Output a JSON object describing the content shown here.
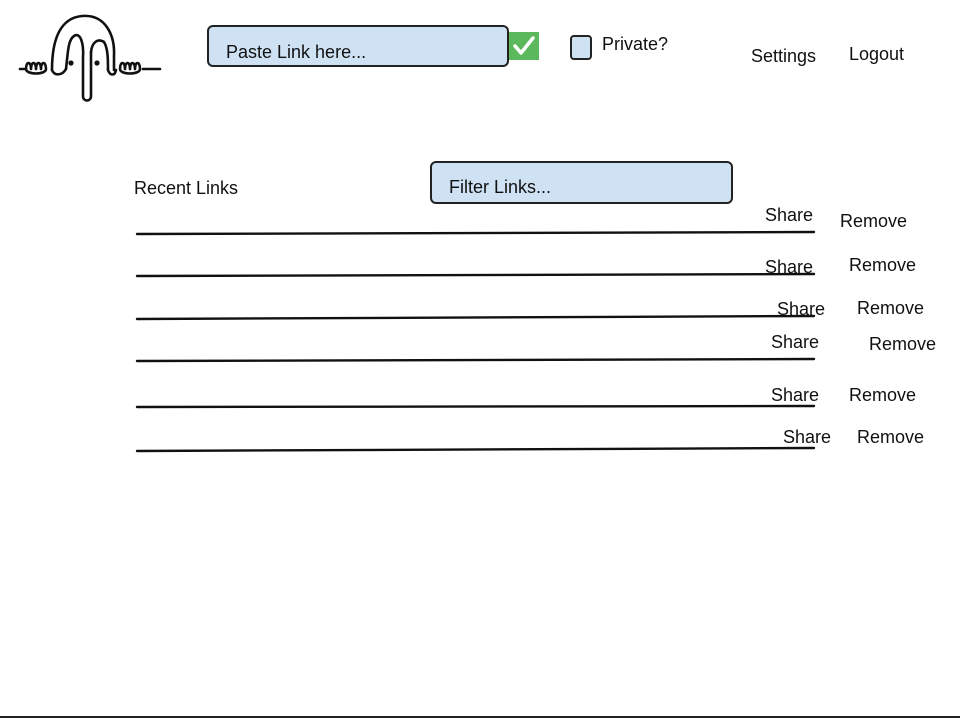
{
  "header": {
    "link_input": {
      "placeholder": "Paste Link here..."
    },
    "submit_icon": "checkmark-icon",
    "submit_color": "#5cb85c",
    "private_label": "Private?",
    "private_checked": false,
    "settings_label": "Settings",
    "logout_label": "Logout"
  },
  "recent": {
    "title": "Recent Links",
    "filter": {
      "placeholder": "Filter Links..."
    },
    "rows": [
      {
        "share_label": "Share",
        "remove_label": "Remove"
      },
      {
        "share_label": "Share",
        "remove_label": "Remove"
      },
      {
        "share_label": "Share",
        "remove_label": "Remove"
      },
      {
        "share_label": "Share",
        "remove_label": "Remove"
      },
      {
        "share_label": "Share",
        "remove_label": "Remove"
      },
      {
        "share_label": "Share",
        "remove_label": "Remove"
      }
    ]
  },
  "colors": {
    "input_fill": "#cfe2f3",
    "outline": "#222222"
  }
}
